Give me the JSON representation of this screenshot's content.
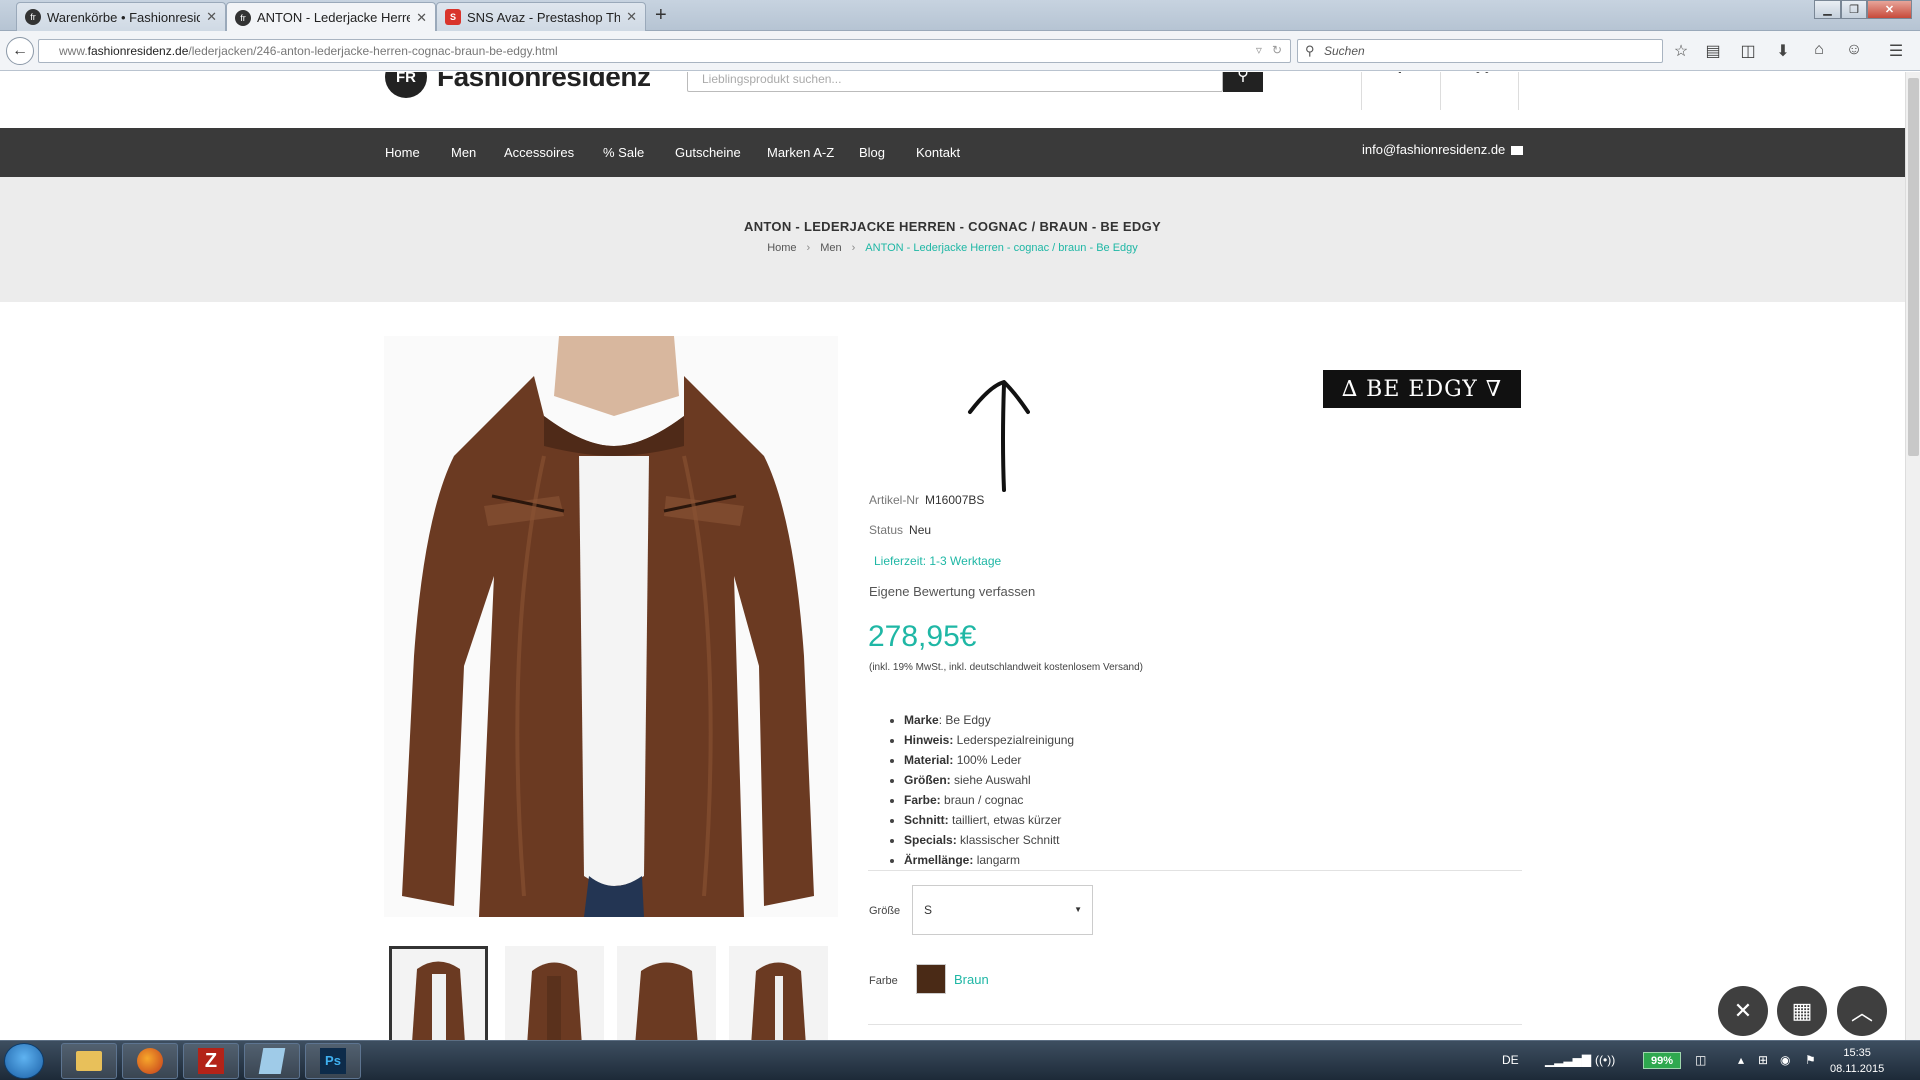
{
  "browser": {
    "tabs": [
      {
        "title": "Warenkörbe • Fashionresid...",
        "favicon": "fr"
      },
      {
        "title": "ANTON - Lederjacke Herre...",
        "favicon": "fr",
        "active": true
      },
      {
        "title": "SNS Avaz - Prestashop The...",
        "favicon": "S"
      }
    ],
    "url_prefix": "www.",
    "url_host": "fashionresidenz.de",
    "url_path": "/lederjacken/246-anton-lederjacke-herren-cognac-braun-be-edgy.html",
    "search_placeholder": "Suchen"
  },
  "site": {
    "logo_mark": "FR",
    "logo_text": "Fashionresidenz",
    "search_placeholder": "Lieblingsprodukt suchen...",
    "nav": [
      "Home",
      "Men",
      "Accessoires",
      "% Sale",
      "Gutscheine",
      "Marken A-Z",
      "Blog",
      "Kontakt"
    ],
    "email": "info@fashionresidenz.de"
  },
  "product": {
    "title": "ANTON - LEDERJACKE HERREN - COGNAC / BRAUN - BE EDGY",
    "breadcrumb": [
      "Home",
      "Men",
      "ANTON - Lederjacke Herren - cognac / braun - Be Edgy"
    ],
    "brand_logo": "∆ BE EDGY ∇",
    "article_label": "Artikel-Nr",
    "article_value": "M16007BS",
    "status_label": "Status",
    "status_value": "Neu",
    "delivery": "Lieferzeit: 1-3 Werktage",
    "review": "Eigene Bewertung verfassen",
    "price": "278,95€",
    "price_note": "(inkl. 19% MwSt., inkl. deutschlandweit kostenlosem Versand)",
    "features": [
      {
        "k": "Marke",
        "v": ": Be Edgy"
      },
      {
        "k": "Hinweis:",
        "v": " Lederspezialreinigung"
      },
      {
        "k": "Material:",
        "v": " 100% Leder"
      },
      {
        "k": "Größen:",
        "v": " siehe Auswahl"
      },
      {
        "k": "Farbe:",
        "v": " braun / cognac"
      },
      {
        "k": "Schnitt:",
        "v": " tailliert, etwas kürzer"
      },
      {
        "k": "Specials:",
        "v": " klassischer Schnitt"
      },
      {
        "k": "Ärmellänge:",
        "v": " langarm"
      }
    ],
    "size_label": "Größe",
    "size_value": "S",
    "color_label": "Farbe",
    "color_value": "Braun",
    "color_hex": "#4a2a16"
  },
  "taskbar": {
    "lang": "DE",
    "battery": "99%",
    "time": "15:35",
    "date": "08.11.2015",
    "apps": [
      "explorer",
      "firefox",
      "FileZilla",
      "notepad",
      "Ps"
    ]
  },
  "colors": {
    "accent": "#1fb7a5",
    "nav_bg": "#3a3a3a"
  }
}
